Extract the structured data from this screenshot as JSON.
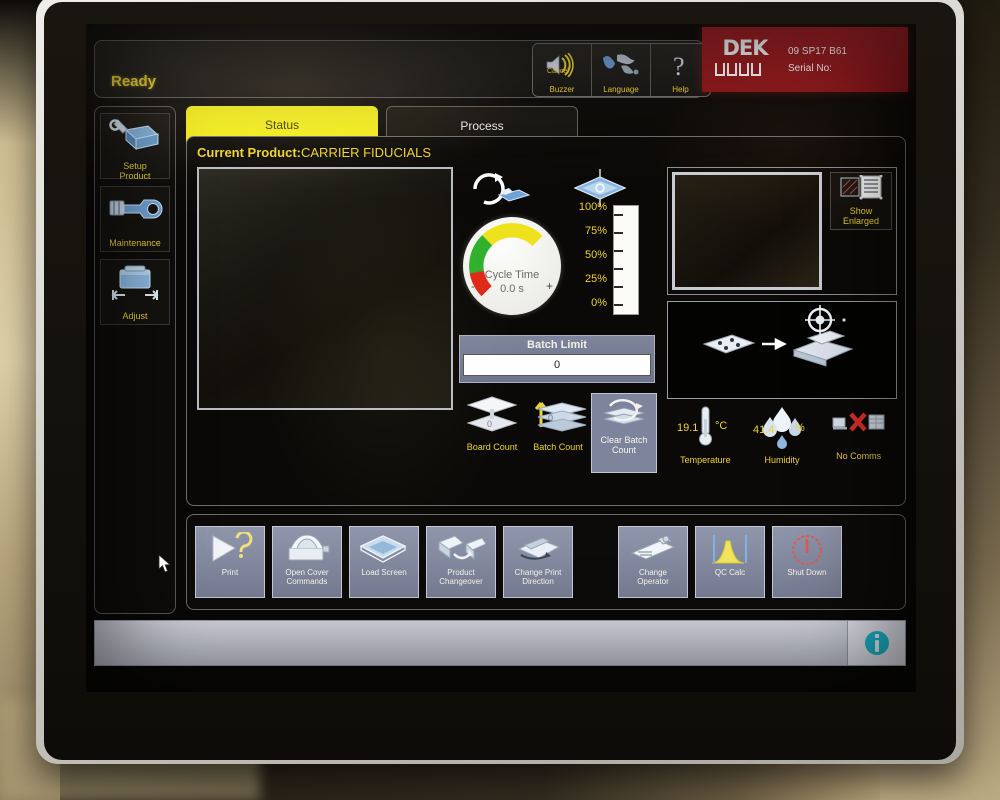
{
  "machine": {
    "brand": "DEK",
    "model_code": "09 SP17 B61",
    "serial_label": "Serial No:",
    "serial_value": ""
  },
  "statusbar": {
    "state": "Ready"
  },
  "header_buttons": [
    {
      "label_line1": "Cancel",
      "label_line2": "Buzzer",
      "icon": "speaker-cancel-icon"
    },
    {
      "label_line1": "Language",
      "label_line2": "",
      "icon": "globe-map-icon"
    },
    {
      "label_line1": "Help",
      "label_line2": "",
      "icon": "question-mark-icon"
    }
  ],
  "sidebar": {
    "items": [
      {
        "label_line1": "Setup",
        "label_line2": "Product",
        "icon": "setup-product-icon"
      },
      {
        "label_line1": "Maintenance",
        "label_line2": "",
        "icon": "wrench-icon"
      },
      {
        "label_line1": "Adjust",
        "label_line2": "",
        "icon": "adjust-icon"
      }
    ]
  },
  "tabs": [
    {
      "label": "Status",
      "active": true
    },
    {
      "label": "Process",
      "active": false
    }
  ],
  "main": {
    "current_product_label": "Current Product:",
    "current_product_value": "CARRIER FIDUCIALS"
  },
  "gauge": {
    "title": "Cycle Time",
    "value": "0.0 s",
    "minus": "-",
    "plus": "+",
    "zones": {
      "low": "#e02817",
      "good": "#2fb02c",
      "high": "#f0e11d"
    }
  },
  "scale": {
    "ticks": [
      "100%",
      "75%",
      "50%",
      "25%",
      "0%"
    ],
    "fill_percent": 0
  },
  "batch": {
    "label": "Batch Limit",
    "value": "0"
  },
  "counters": [
    {
      "label_line1": "Board Count",
      "label_line2": "",
      "value": "0",
      "icon": "board-count-icon",
      "is_button": false
    },
    {
      "label_line1": "Batch Count",
      "label_line2": "",
      "value": "0",
      "icon": "batch-count-icon",
      "is_button": false
    },
    {
      "label_line1": "Clear Batch",
      "label_line2": "Count",
      "value": "",
      "icon": "clear-batch-count-icon",
      "is_button": true
    }
  ],
  "camera": {
    "show_enlarged_line1": "Show",
    "show_enlarged_line2": "Enlarged",
    "show_enlarged_icon": "show-enlarged-icon"
  },
  "sensors": [
    {
      "label": "Temperature",
      "value": "19.1 °C",
      "icon": "thermometer-icon"
    },
    {
      "label": "Humidity",
      "value": "41.4 %",
      "icon": "humidity-droplet-icon"
    },
    {
      "label": "No Comms",
      "value": "",
      "icon": "no-comms-icon"
    }
  ],
  "toolbar": [
    {
      "label_line1": "Print",
      "label_line2": "",
      "icon": "print-icon"
    },
    {
      "label_line1": "Open Cover",
      "label_line2": "Commands",
      "icon": "open-cover-icon"
    },
    {
      "label_line1": "Load Screen",
      "label_line2": "",
      "icon": "load-screen-icon"
    },
    {
      "label_line1": "Product",
      "label_line2": "Changeover",
      "icon": "product-changeover-icon"
    },
    {
      "label_line1": "Change Print",
      "label_line2": "Direction",
      "icon": "change-print-direction-icon"
    },
    {
      "label_line1": "Change",
      "label_line2": "Operator",
      "icon": "change-operator-icon"
    },
    {
      "label_line1": "QC Calc",
      "label_line2": "",
      "icon": "qc-calc-icon"
    },
    {
      "label_line1": "Shut Down",
      "label_line2": "",
      "icon": "shut-down-icon"
    }
  ],
  "message_bar": {
    "text": "",
    "info_icon": "info-icon"
  },
  "colors": {
    "accent_yellow": "#f2d32a",
    "tab_active": "#f4ec1a",
    "brand_red": "#a81c22",
    "button_blue_grey": "#8f95ab"
  }
}
